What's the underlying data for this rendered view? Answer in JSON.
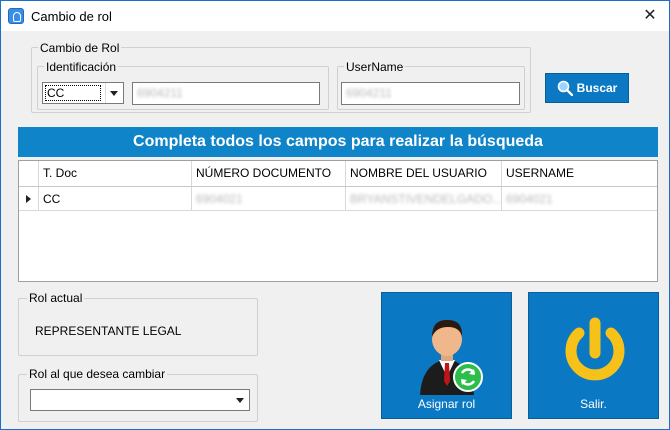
{
  "window": {
    "title": "Cambio de rol",
    "close_glyph": "✕",
    "icon": "app-fingerprint-icon"
  },
  "search_group": {
    "legend": "Cambio de Rol",
    "identificacion": {
      "legend": "Identificación",
      "doc_type": "CC",
      "doc_number": "6904211"
    },
    "username": {
      "legend": "UserName",
      "value": "6904211"
    },
    "search_button": {
      "label": "Buscar",
      "icon": "magnifier-icon"
    }
  },
  "banner": {
    "text": "Completa todos los campos para realizar la búsqueda"
  },
  "grid": {
    "columns": [
      "T. Doc",
      "NÚMERO DOCUMENTO",
      "NOMBRE DEL USUARIO",
      "USERNAME"
    ],
    "rows": [
      {
        "t_doc": "CC",
        "numero": "6904021",
        "nombre": "BRYANSTIVENDELGADO...",
        "username": "6904021"
      }
    ]
  },
  "rol_actual": {
    "legend": "Rol actual",
    "value": "REPRESENTANTE LEGAL"
  },
  "rol_cambiar": {
    "legend": "Rol al que desea cambiar",
    "value": ""
  },
  "buttons": {
    "asignar": {
      "label": "Asignar rol",
      "icon": "user-refresh-icon"
    },
    "salir": {
      "label": "Salir.",
      "icon": "power-icon"
    }
  },
  "colors": {
    "accent": "#0a78c2",
    "banner": "#0f84c8",
    "window_border": "#1b6fc9"
  }
}
